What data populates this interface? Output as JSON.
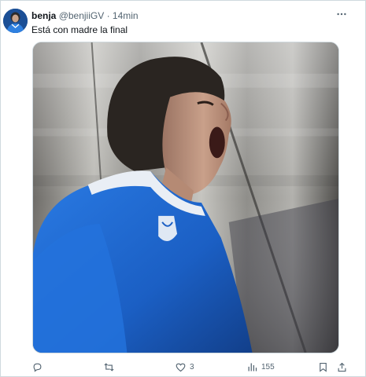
{
  "author": {
    "name": "benja",
    "handle": "@benjiiGV",
    "separator": "·",
    "time": "14min"
  },
  "tweet": {
    "text": "Está con madre la final"
  },
  "media": {
    "description_icon": "photo"
  },
  "actions": {
    "reply_count": "",
    "retweet_count": "",
    "like_count": "3",
    "views_count": "155"
  },
  "colors": {
    "text_primary": "#0f1419",
    "text_secondary": "#536471",
    "border": "#cfd9de",
    "jersey_blue": "#1e63c8"
  }
}
